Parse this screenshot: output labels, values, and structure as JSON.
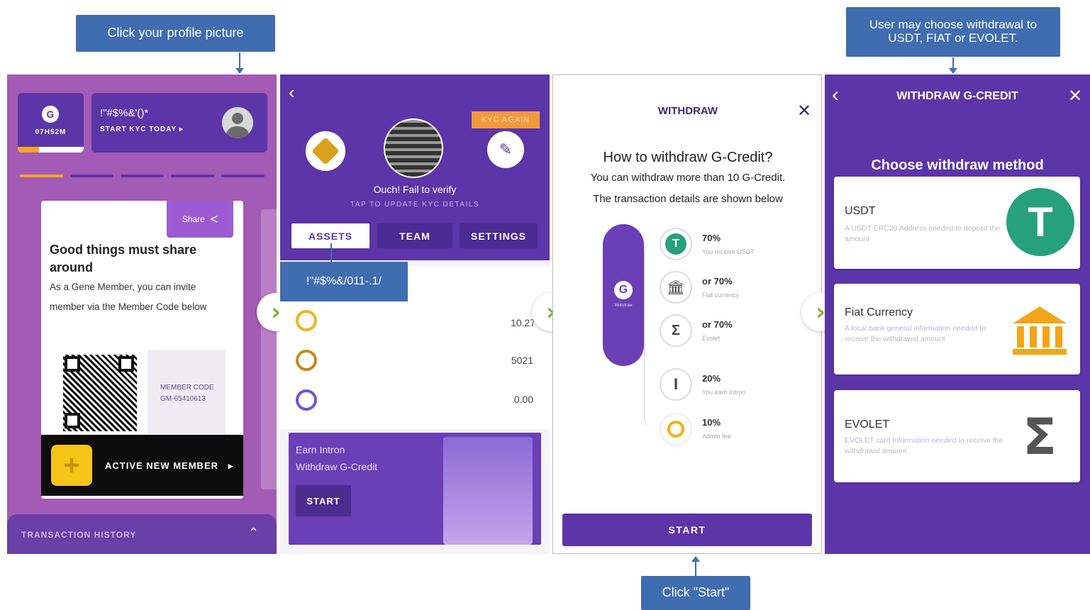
{
  "callouts": {
    "profile": "Click your profile picture",
    "withdraw_choice": "User may choose withdrawal to USDT, FIAT or EVOLET.",
    "start": "Click \"Start\""
  },
  "screen1": {
    "timer": "07H52M",
    "garbled_name": "!\"#$%&'()*",
    "kyc_link": "START KYC TODAY",
    "share_label": "Share",
    "headline": "Good things must share around",
    "body": "As a Gene Member, you can invite member via the Member Code below",
    "member_code_label": "MEMBER CODE",
    "member_code": "GM-65410613",
    "active_new_member": "ACTIVE NEW MEMBER",
    "transaction_history": "TRANSACTION HISTORY"
  },
  "screen2": {
    "kyc_again": "KYC AGAIN",
    "fail_text": "Ouch! Fail to verify",
    "update_text": "TAP TO UPDATE KYC DETAILS",
    "tabs": [
      "ASSETS",
      "TEAM",
      "SETTINGS"
    ],
    "tooltip": "!\"#$%&/011-.1/",
    "assets": [
      {
        "value": "10.27"
      },
      {
        "value": "5021"
      },
      {
        "value": "0.00"
      }
    ],
    "promo_line1": "Earn Intron",
    "promo_line2": "Withdraw G-Credit",
    "promo_button": "START"
  },
  "screen3": {
    "title": "WITHDRAW",
    "heading": "How to withdraw G-Credit?",
    "line1": "You can withdraw more than 10 G-Credit.",
    "line2": "The transaction details are shown below",
    "pill_label": "Withdraw",
    "options": [
      {
        "pct": "70%",
        "sub": "You receive USDT"
      },
      {
        "pct": "or 70%",
        "sub": "Fiat currency"
      },
      {
        "pct": "or 70%",
        "sub": "Evolet"
      },
      {
        "pct": "20%",
        "sub": "You earn Intron"
      },
      {
        "pct": "10%",
        "sub": "Admin fee"
      }
    ],
    "start": "START"
  },
  "screen4": {
    "title": "WITHDRAW G-CREDIT",
    "heading": "Choose withdraw method",
    "methods": [
      {
        "name": "USDT",
        "desc": "A USDT ERC20 Address needed to deposit the amount"
      },
      {
        "name": "Fiat Currency",
        "desc": "A local bank general information needed to receive the withdrawal amount"
      },
      {
        "name": "EVOLET",
        "desc": "EVOLET card information needed to receive the withdrawal amount"
      }
    ]
  },
  "colors": {
    "callout": "#3f6db0",
    "purple": "#5c36a8",
    "next_arrow": "#7ab530",
    "kyc_orange": "#f39a3d",
    "tether_teal": "#26a17b"
  }
}
